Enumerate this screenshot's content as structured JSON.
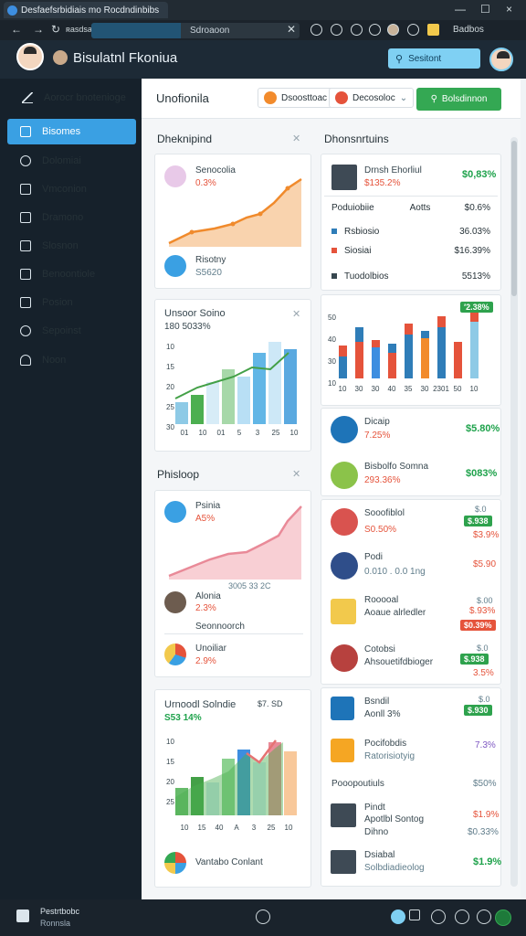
{
  "window": {
    "tab_title": "Desfaefsrbidiais  mo  Rocdndinbibs",
    "close": "×",
    "minimize": "—",
    "maximize": "☐"
  },
  "addressbar": {
    "back": "←",
    "forward": "→",
    "reload": "↻",
    "url": "ʀasdsa",
    "search_text": "Sdroaoon",
    "clear": "✕",
    "profile_label": "Badbos"
  },
  "header": {
    "app_title": "Bisulatnl Fkoniua",
    "search_label": "Sesitont"
  },
  "sidebar": {
    "items": [
      {
        "label": "Aorocr bnotenioge"
      },
      {
        "label": "Bisomes"
      },
      {
        "label": "Dolomiai"
      },
      {
        "label": "Vmconion"
      },
      {
        "label": "Dramono"
      },
      {
        "label": "Slosnon"
      },
      {
        "label": "Benoontiole"
      },
      {
        "label": "Posion"
      },
      {
        "label": "Sepoinst"
      },
      {
        "label": "Noon"
      }
    ]
  },
  "topstrip": {
    "title": "Unofionila",
    "filter1": "Dsoosttoac",
    "filter2": "Decosoloc",
    "action_button": "Bolsdinnon"
  },
  "left": {
    "section1_title": "Dheknipind",
    "card1": {
      "name": "Senocolia",
      "value": "0.3%",
      "foot_name": "Risotny",
      "foot_value": "S5620"
    },
    "card2": {
      "title": "Unsoor Soino",
      "subtitle": "180 5033%",
      "y_ticks": [
        "10",
        "15",
        "20",
        "25",
        "30"
      ],
      "x_ticks": [
        "01",
        "10",
        "01",
        "5",
        "3",
        "25",
        "10"
      ]
    },
    "section2_title": "Phisloop",
    "card3": {
      "name": "Psinia",
      "value": "A5%",
      "items": [
        {
          "name": "Alonia",
          "value": "2.3%",
          "note": "Seonnoorch"
        },
        {
          "name": "Unoiliar",
          "value": "2.9%"
        }
      ],
      "axis_note": "3005 33 2C"
    },
    "card4": {
      "title": "Urnoodl Solndie",
      "subtitle": "S53 14%",
      "right_note": "$7.  SD",
      "y_ticks": [
        "10",
        "15",
        "20",
        "25"
      ],
      "x_ticks": [
        "10",
        "15",
        "40",
        "A",
        "3",
        "25",
        "10"
      ],
      "foot": "Vantabo Conlant"
    }
  },
  "right": {
    "section_title": "Dhonsnrtuins",
    "profile": {
      "name": "Drnsh Ehorliul",
      "amount": "$135.2%",
      "value": "$0,83%"
    },
    "table_head": {
      "label": "Poduiobiie",
      "col2": "Aotts",
      "col3": "$0.6%"
    },
    "table_rows": [
      {
        "label": "Rsbiosio",
        "value": "36.03%",
        "color": "#2f7db8"
      },
      {
        "label": "Siosiai",
        "value": "$16.39%",
        "color": "#e5533b"
      },
      {
        "label": "Tuodolbios",
        "value": "5513%",
        "color": "#37474f"
      }
    ],
    "chart_badge": "′2.38%",
    "chart_y_ticks": [
      "50",
      "40",
      "30",
      "10"
    ],
    "chart_x_ticks": [
      "10",
      "30",
      "30",
      "40",
      "35",
      "30",
      "2301",
      "50",
      "10"
    ],
    "metrics": [
      {
        "name": "Dicaip",
        "sub": "7.25%",
        "value": "$5.80%"
      },
      {
        "name": "Bisbolfo Somna",
        "sub": "293.36%",
        "value": "$083%"
      }
    ],
    "list1": [
      {
        "name": "Sooofiblol",
        "sub": "S0.50%",
        "top": "$.0",
        "value": "$.938",
        "value2": "$3.9%"
      },
      {
        "name": "Podi",
        "sub": "0.010 . 0.0 1ng",
        "top": "",
        "value": "$5.90",
        "value2": ""
      },
      {
        "name": "Rooooal",
        "sub": "Aoaue alrledler",
        "top": "$.00",
        "value": "$.93%",
        "value2": "$0.39%"
      },
      {
        "name": "Cotobsi",
        "sub": "Ahsouetifdbioger",
        "top": "$.0",
        "value": "$.938",
        "value2": "3.5%"
      }
    ],
    "list2": [
      {
        "name": "Bsndil",
        "sub": "Aonll 3%",
        "top": "$.0",
        "value": "$.930"
      },
      {
        "name": "Pocifobdis",
        "sub": "Ratorisiotyig",
        "value": "7.3%"
      }
    ],
    "list2_head": {
      "label": "Pooopoutiuls",
      "value": "$50%"
    },
    "list3": [
      {
        "name": "Pindt",
        "sub": "Apotlbl Sontog",
        "sub2": "Dihno",
        "value": "$1.9%",
        "value2": "$0.33%"
      },
      {
        "name": "Dsiabal",
        "sub": "Solbdiadieolog",
        "value": "$1.9%"
      }
    ]
  },
  "bottombar": {
    "left_label": "Pestrtbobc",
    "left_sub": "Ronnsla"
  },
  "colors": {
    "accent": "#3aa0e3",
    "success": "#34a853",
    "danger": "#e5533b",
    "dark": "#16212b"
  }
}
